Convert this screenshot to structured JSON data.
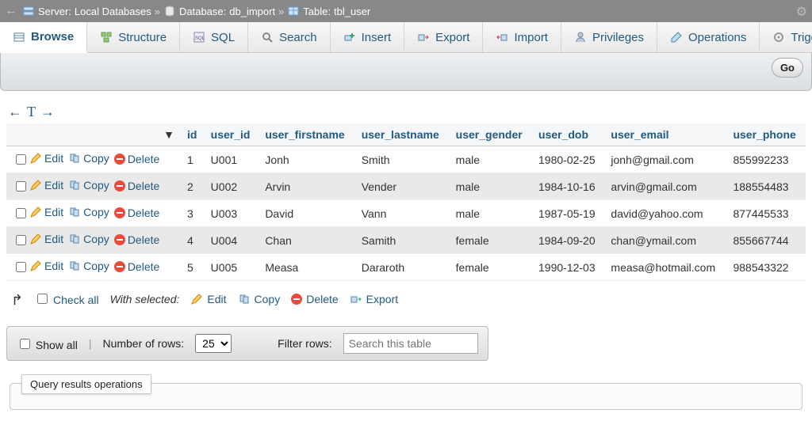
{
  "breadcrumb": {
    "server_label": "Server:",
    "server_name": "Local Databases",
    "database_label": "Database:",
    "database_name": "db_import",
    "table_label": "Table:",
    "table_name": "tbl_user"
  },
  "tabs": {
    "browse": "Browse",
    "structure": "Structure",
    "sql": "SQL",
    "search": "Search",
    "insert": "Insert",
    "export": "Export",
    "import": "Import",
    "privileges": "Privileges",
    "operations": "Operations",
    "triggers": "Triggers"
  },
  "go_button": "Go",
  "columns": {
    "id": "id",
    "user_id": "user_id",
    "user_firstname": "user_firstname",
    "user_lastname": "user_lastname",
    "user_gender": "user_gender",
    "user_dob": "user_dob",
    "user_email": "user_email",
    "user_phone": "user_phone"
  },
  "row_actions": {
    "edit": "Edit",
    "copy": "Copy",
    "delete": "Delete"
  },
  "rows": [
    {
      "id": "1",
      "user_id": "U001",
      "fn": "Jonh",
      "ln": "Smith",
      "g": "male",
      "dob": "1980-02-25",
      "em": "jonh@gmail.com",
      "ph": "855992233"
    },
    {
      "id": "2",
      "user_id": "U002",
      "fn": "Arvin",
      "ln": "Vender",
      "g": "male",
      "dob": "1984-10-16",
      "em": "arvin@gmail.com",
      "ph": "188554483"
    },
    {
      "id": "3",
      "user_id": "U003",
      "fn": "David",
      "ln": "Vann",
      "g": "male",
      "dob": "1987-05-19",
      "em": "david@yahoo.com",
      "ph": "877445533"
    },
    {
      "id": "4",
      "user_id": "U004",
      "fn": "Chan",
      "ln": "Samith",
      "g": "female",
      "dob": "1984-09-20",
      "em": "chan@ymail.com",
      "ph": "855667744"
    },
    {
      "id": "5",
      "user_id": "U005",
      "fn": "Measa",
      "ln": "Dararoth",
      "g": "female",
      "dob": "1990-12-03",
      "em": "measa@hotmail.com",
      "ph": "988543322"
    }
  ],
  "checkall": {
    "label": "Check all",
    "with_selected": "With selected:",
    "edit": "Edit",
    "copy": "Copy",
    "delete": "Delete",
    "export": "Export"
  },
  "showall": {
    "show_all": "Show all",
    "number_of_rows": "Number of rows:",
    "rows_value": "25",
    "filter_rows": "Filter rows:",
    "filter_placeholder": "Search this table"
  },
  "qro_legend": "Query results operations"
}
